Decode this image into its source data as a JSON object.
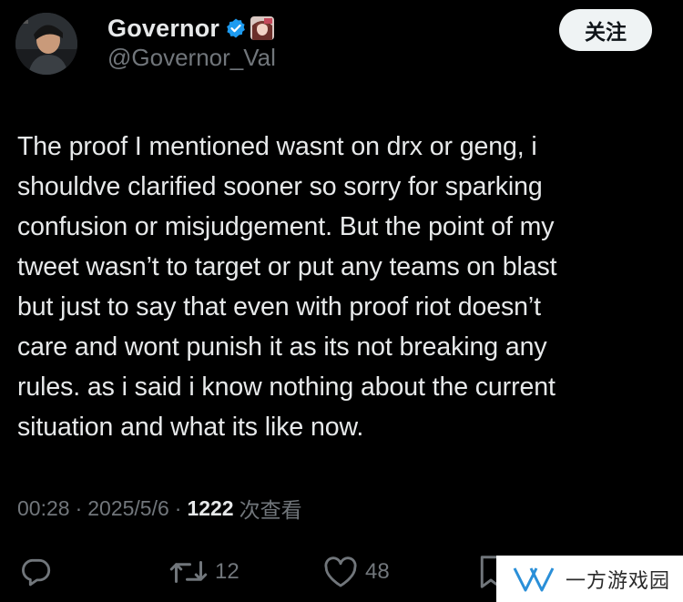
{
  "user": {
    "display_name": "Governor",
    "handle": "@Governor_Val",
    "avatar_icon": "avatar-photo-icon",
    "badge_icon": "anime-avatar-badge-icon"
  },
  "follow_button": {
    "label": "关注"
  },
  "tweet": {
    "text": "The proof I mentioned wasnt on drx or geng, i\nshouldve clarified sooner so sorry for sparking\nconfusion or misjudgement. But the point of my\ntweet wasn’t to target or put any teams on blast\nbut just to say that even with proof riot doesn’t\ncare and wont punish it as its not breaking any\nrules. as i said i know nothing about the current\nsituation and what its like now."
  },
  "meta": {
    "time": "00:28",
    "separator": "·",
    "date": "2025/5/6",
    "views_count": "1222",
    "views_label": "次查看"
  },
  "actions": {
    "reply_icon": "reply-icon",
    "retweet_count": "12",
    "like_count": "48",
    "bookmark_icon": "bookmark-icon"
  },
  "watermark": {
    "text": "一方游戏园"
  },
  "colors": {
    "background": "#000000",
    "text_primary": "#e7e9ea",
    "text_secondary": "#71767b",
    "verified": "#1d9bf0",
    "follow_bg": "#eff3f4"
  }
}
